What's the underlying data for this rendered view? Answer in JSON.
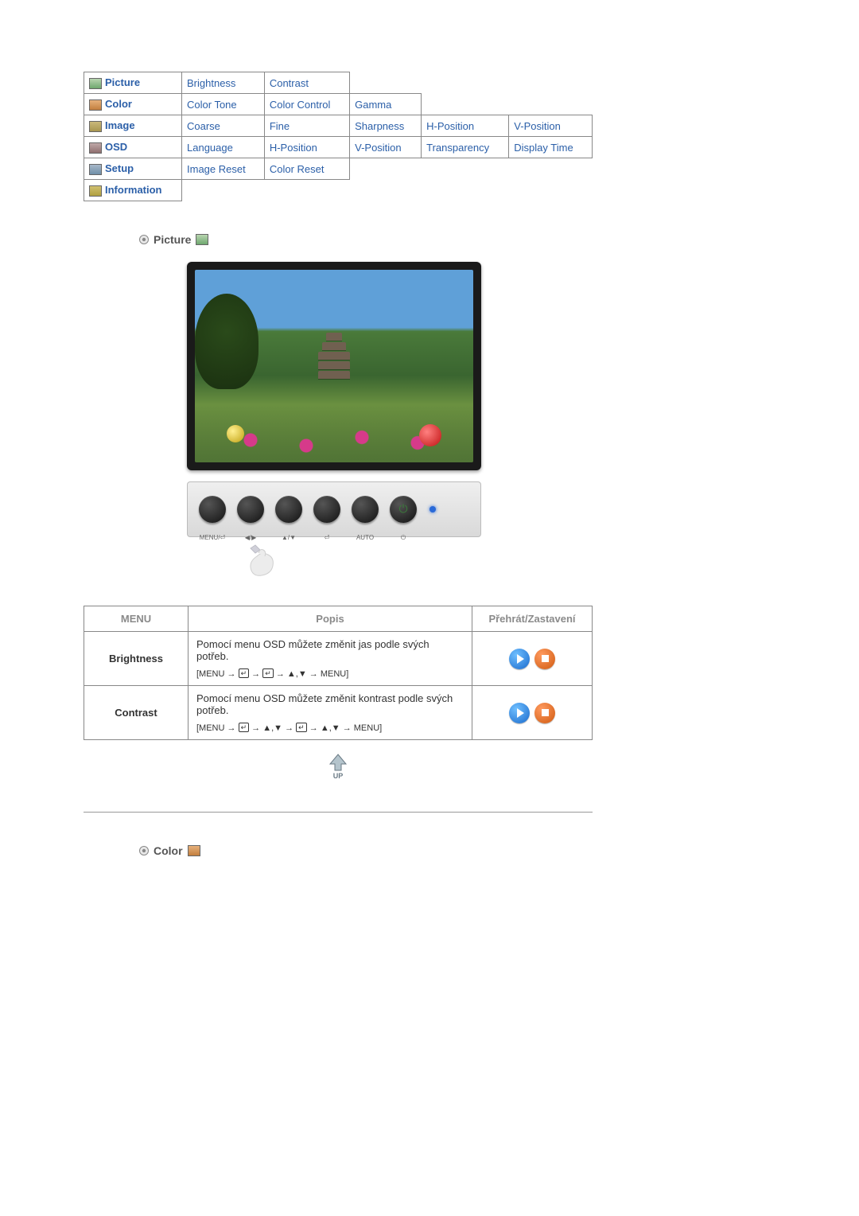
{
  "menu_map": {
    "rows": [
      {
        "icon": "ic-picture",
        "category": "Picture",
        "name": "picture",
        "subs": [
          "Brightness",
          "Contrast"
        ]
      },
      {
        "icon": "ic-color",
        "category": "Color",
        "name": "color",
        "subs": [
          "Color Tone",
          "Color Control",
          "Gamma"
        ]
      },
      {
        "icon": "ic-image",
        "category": "Image",
        "name": "image",
        "subs": [
          "Coarse",
          "Fine",
          "Sharpness",
          "H-Position",
          "V-Position"
        ]
      },
      {
        "icon": "ic-osd",
        "category": "OSD",
        "name": "osd",
        "subs": [
          "Language",
          "H-Position",
          "V-Position",
          "Transparency",
          "Display Time"
        ]
      },
      {
        "icon": "ic-setup",
        "category": "Setup",
        "name": "setup",
        "subs": [
          "Image Reset",
          "Color Reset"
        ]
      },
      {
        "icon": "ic-info",
        "category": "Information",
        "name": "information",
        "subs": []
      }
    ],
    "max_cols": 5
  },
  "sections": {
    "picture_heading": "Picture",
    "color_heading": "Color"
  },
  "button_panel": {
    "labels": [
      "MENU/⏎",
      "◀/▶",
      "▲/▼",
      "⏎",
      "AUTO",
      "⏻"
    ]
  },
  "desc_table": {
    "headers": {
      "menu": "MENU",
      "desc": "Popis",
      "play": "Přehrát/Zastavení"
    },
    "rows": [
      {
        "label": "Brightness",
        "text": "Pomocí menu OSD můžete změnit jas podle svých potřeb.",
        "seq_html": "[MENU → ⏎ → ⏎ → ▲,▼ → MENU]"
      },
      {
        "label": "Contrast",
        "text": "Pomocí menu OSD můžete změnit kontrast podle svých potřeb.",
        "seq_html": "[MENU → ⏎ → ▲,▼ → ⏎ → ▲,▼ → MENU]"
      }
    ]
  },
  "up_label": "UP"
}
